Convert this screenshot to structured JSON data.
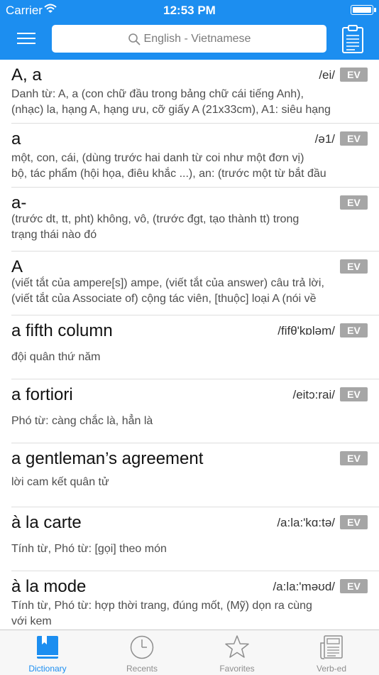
{
  "status_bar": {
    "carrier": "Carrier",
    "time": "12:53 PM"
  },
  "header": {
    "search_placeholder": "English - Vietnamese"
  },
  "entries": [
    {
      "word": "A, a",
      "pron": "/ei/",
      "badge": "EV",
      "def": [
        "Danh từ: A, a (con chữ đầu trong bảng chữ cái tiếng Anh),",
        "(nhạc) la, hạng A, hạng ưu, cỡ giấy A (21x33cm), A1: siêu hạng"
      ]
    },
    {
      "word": "a",
      "pron": "/ə1/",
      "badge": "EV",
      "def": [
        "một, con, cái, (dùng trước hai danh từ coi như một đơn vị)",
        "bộ, tác phẩm (hội họa, điêu khắc ...), an: (trước một từ bắt đầu"
      ]
    },
    {
      "word": "a-",
      "pron": "",
      "badge": "EV",
      "def": [
        "(trước dt, tt, pht) không, vô, (trước đgt, tạo thành tt) trong",
        "trạng thái nào đó"
      ]
    },
    {
      "word": "A",
      "pron": "",
      "badge": "EV",
      "def": [
        "(viết tắt của ampere[s]) ampe, (viết tắt của answer) câu trả lời,",
        "(viết tắt của Associate of) cộng tác viên, [thuộc] loại A (nói về"
      ]
    },
    {
      "word": "a fifth column",
      "pron": "/fifθ'kɒləm/",
      "badge": "EV",
      "def": [
        "đội quân thứ năm"
      ]
    },
    {
      "word": "a fortiori",
      "pron": "/eitɔ:rai/",
      "badge": "EV",
      "def": [
        "Phó từ: càng chắc là, hẳn là"
      ]
    },
    {
      "word": "a gentleman’s agreement",
      "pron": "",
      "badge": "EV",
      "def": [
        "lời cam kết quân tử"
      ]
    },
    {
      "word": "à la carte",
      "pron": "/a:la:'kɑ:tə/",
      "badge": "EV",
      "def": [
        "Tính từ, Phó từ: [gọi] theo món"
      ]
    },
    {
      "word": "à la mode",
      "pron": "/a:la:'məʊd/",
      "badge": "EV",
      "def": [
        "Tính từ, Phó từ: hợp thời trang, đúng mốt, (Mỹ) dọn ra cùng",
        "với kem"
      ]
    }
  ],
  "tabs": [
    {
      "label": "Dictionary",
      "icon": "book-icon"
    },
    {
      "label": "Recents",
      "icon": "clock-icon"
    },
    {
      "label": "Favorites",
      "icon": "star-icon"
    },
    {
      "label": "Verb-ed",
      "icon": "document-icon"
    }
  ],
  "colors": {
    "accent": "#1c8ef0",
    "badge": "#a6a6a6",
    "tab_inactive": "#8e8e8e"
  }
}
